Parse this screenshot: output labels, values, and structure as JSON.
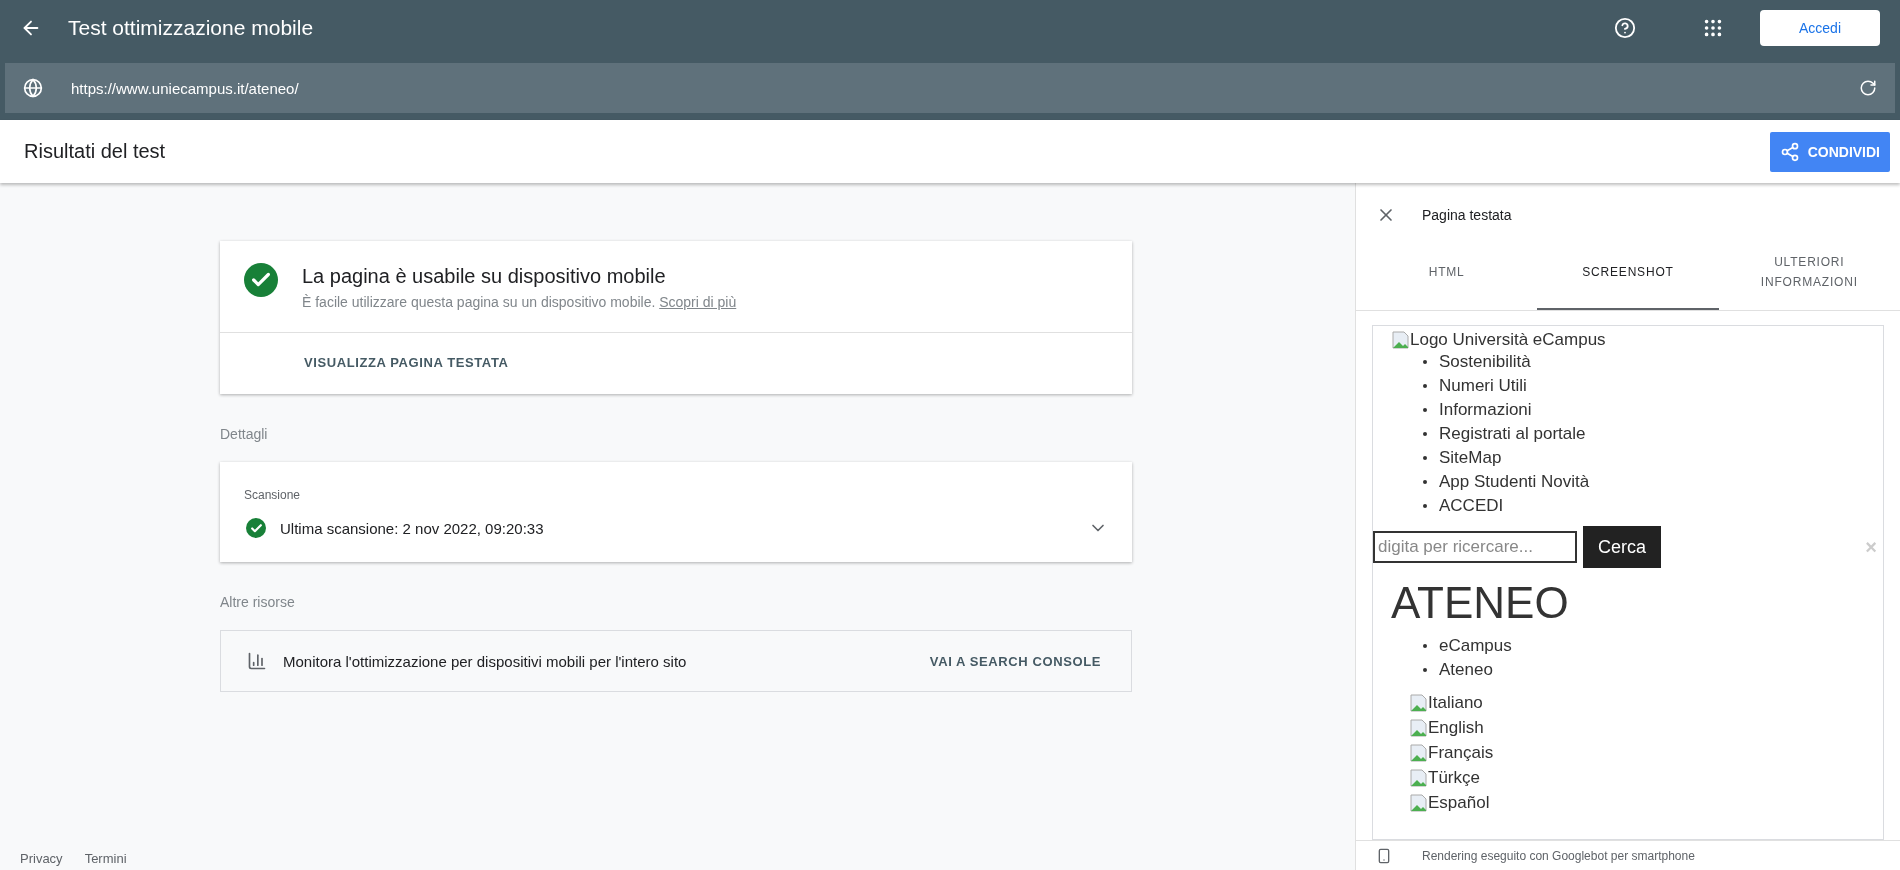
{
  "app_bar": {
    "title": "Test ottimizzazione mobile",
    "sign_in": "Accedi"
  },
  "url_bar": {
    "value": "https://www.uniecampus.it/ateneo/"
  },
  "results_header": {
    "title": "Risultati del test",
    "share": "CONDIVIDI"
  },
  "verdict_card": {
    "title": "La pagina è usabile su dispositivo mobile",
    "description": "È facile utilizzare questa pagina su un dispositivo mobile.",
    "link": "Scopri di più",
    "action": "VISUALIZZA PAGINA TESTATA"
  },
  "details": {
    "heading": "Dettagli",
    "section": "Scansione",
    "row": "Ultima scansione: 2 nov 2022, 09:20:33",
    "expanded": false
  },
  "resources": {
    "heading": "Altre risorse",
    "text": "Monitora l'ottimizzazione per dispositivi mobili per l'intero sito",
    "action": "VAI A SEARCH CONSOLE"
  },
  "footer": [
    "Privacy",
    "Termini"
  ],
  "panel": {
    "title": "Pagina testata",
    "tabs": [
      {
        "label": "HTML",
        "selected": false
      },
      {
        "label": "SCREENSHOT",
        "selected": true
      },
      {
        "label": "ULTERIORI INFORMAZIONI",
        "selected": false
      }
    ],
    "preview": {
      "logo_alt": "Logo Università eCampus",
      "menu": [
        "Sostenibilità",
        "Numeri Utili",
        "Informazioni",
        "Registrati al portale",
        "SiteMap",
        "App Studenti Novità",
        "ACCEDI"
      ],
      "search_placeholder": "digita per ricercare...",
      "search_button": "Cerca",
      "close": "×",
      "heading": "ATENEO",
      "breadcrumbs": [
        "eCampus",
        "Ateneo"
      ],
      "languages": [
        "Italiano",
        "English",
        "Français",
        "Türkçe",
        "Español"
      ]
    },
    "status": "Rendering eseguito con Googlebot per smartphone"
  }
}
